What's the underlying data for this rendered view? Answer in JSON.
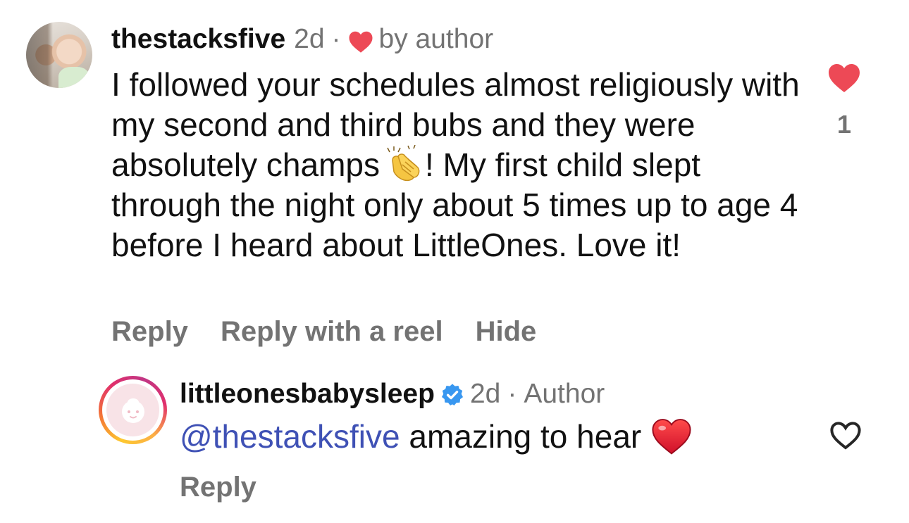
{
  "comments": [
    {
      "username": "thestacksfive",
      "time": "2d",
      "separator": "·",
      "badge": "by author",
      "text_before_emoji": "I followed your schedules almost religiously with my second and third bubs and they were absolutely champs",
      "emoji": "clapping-hands",
      "text_after_emoji": "! My first child slept through the night only about 5 times up to age 4 before I heard about LittleOnes. Love it!",
      "actions": [
        "Reply",
        "Reply with a reel",
        "Hide"
      ],
      "liked": true,
      "like_count": "1"
    },
    {
      "username": "littleonesbabysleep",
      "verified": true,
      "time": "2d",
      "separator": "·",
      "badge": "Author",
      "mention": "@thestacksfive",
      "text": "amazing to hear",
      "emoji": "red-heart",
      "actions": [
        "Reply"
      ],
      "liked": false
    }
  ],
  "colors": {
    "like_red": "#ed4956",
    "secondary_text": "#737373",
    "mention_blue": "#3f51b5",
    "verified_blue": "#3897f0"
  }
}
